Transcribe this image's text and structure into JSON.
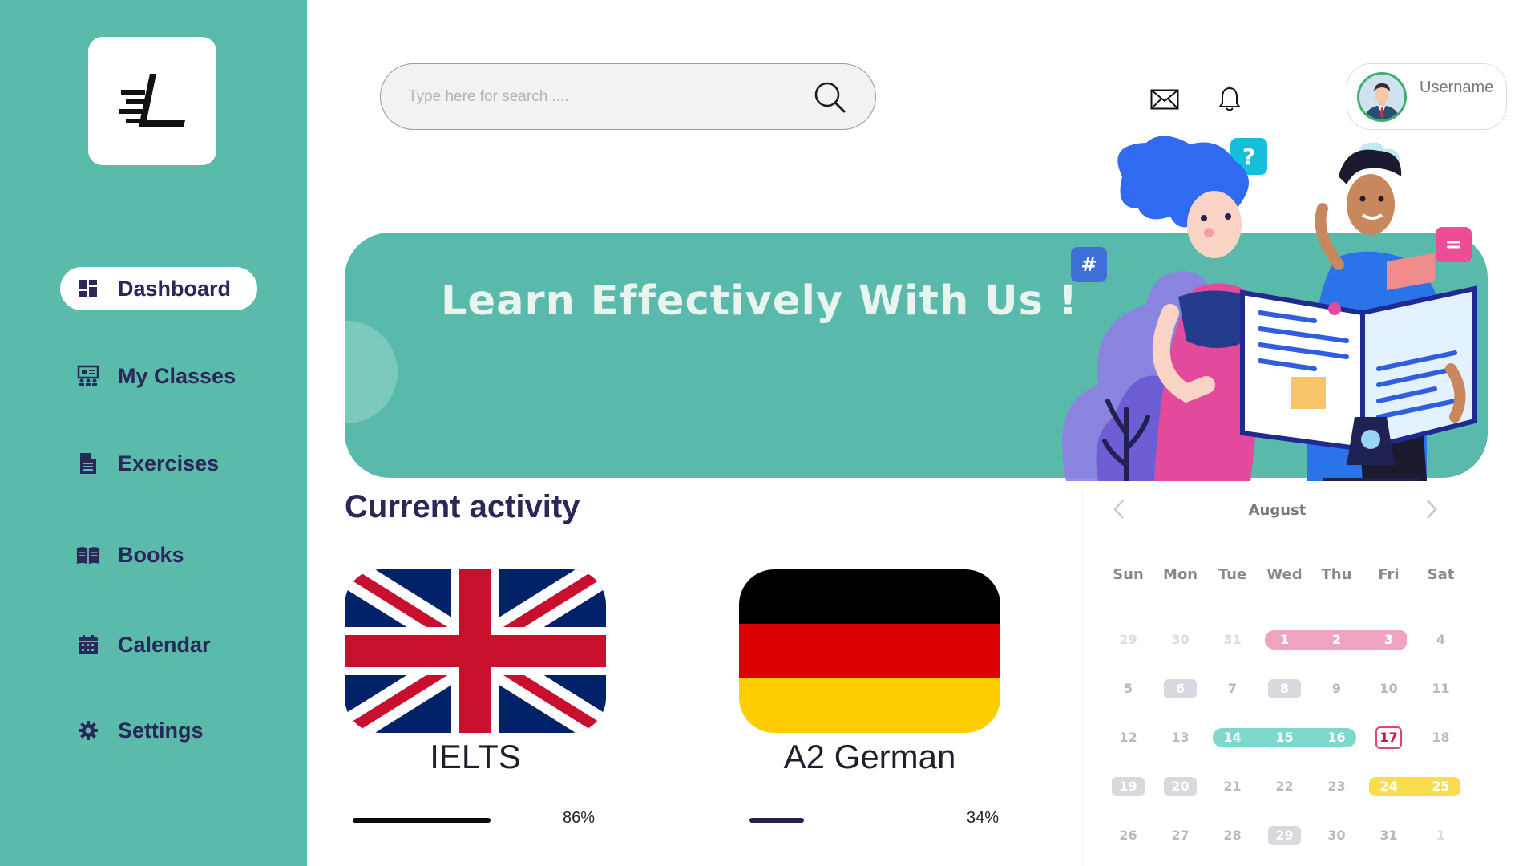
{
  "sidebar": {
    "items": [
      {
        "label": "Dashboard",
        "icon": "dashboard-icon",
        "active": true
      },
      {
        "label": "My Classes",
        "icon": "classes-icon",
        "active": false
      },
      {
        "label": "Exercises",
        "icon": "document-icon",
        "active": false
      },
      {
        "label": "Books",
        "icon": "book-icon",
        "active": false
      },
      {
        "label": "Calendar",
        "icon": "calendar-icon",
        "active": false
      },
      {
        "label": "Settings",
        "icon": "gear-icon",
        "active": false
      }
    ]
  },
  "search": {
    "placeholder": "Type here for search ...."
  },
  "user": {
    "name": "Username"
  },
  "banner": {
    "title": "Learn Effectively With Us !"
  },
  "activity": {
    "title": "Current activity",
    "courses": [
      {
        "name": "IELTS",
        "flag": "uk-flag",
        "progress": 86,
        "progress_label": "86%"
      },
      {
        "name": "A2 German",
        "flag": "germany-flag",
        "progress": 34,
        "progress_label": "34%"
      }
    ]
  },
  "calendar": {
    "month": "August",
    "weekdays": [
      "Sun",
      "Mon",
      "Tue",
      "Wed",
      "Thu",
      "Fri",
      "Sat"
    ],
    "weeks": [
      [
        "29",
        "30",
        "31",
        "1",
        "2",
        "3",
        "4"
      ],
      [
        "5",
        "6",
        "7",
        "8",
        "9",
        "10",
        "11"
      ],
      [
        "12",
        "13",
        "14",
        "15",
        "16",
        "17",
        "18"
      ],
      [
        "19",
        "20",
        "21",
        "22",
        "23",
        "24",
        "25"
      ],
      [
        "26",
        "27",
        "28",
        "29",
        "30",
        "31",
        "1"
      ]
    ]
  },
  "colors": {
    "sidebar": "#5BBBAA",
    "accent_navy": "#2A2859",
    "banner": "#59BAAB",
    "pink": "#EFA3C0",
    "teal": "#7FD8CC",
    "yellow": "#F9DD4E"
  }
}
